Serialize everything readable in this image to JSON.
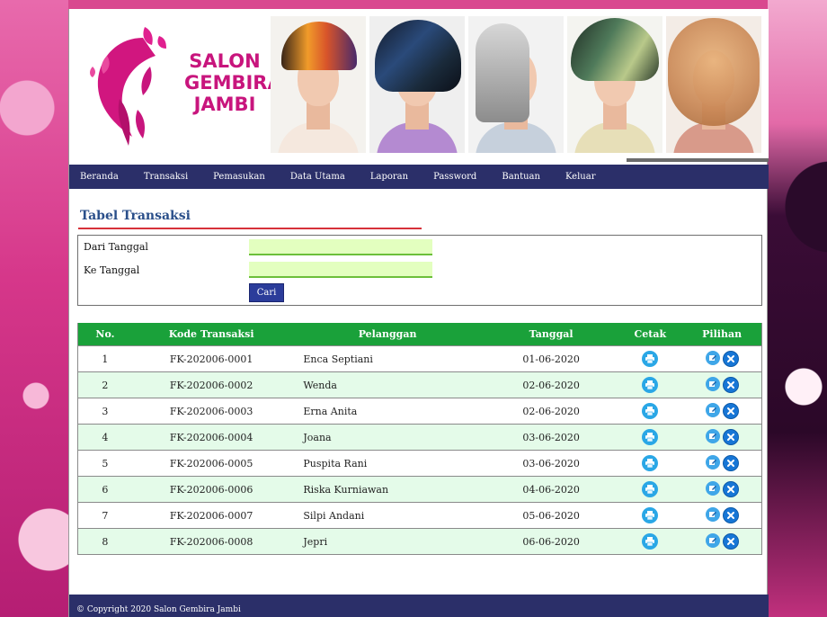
{
  "brand": {
    "name_lines": [
      "SALON",
      "GEMBIRA",
      "JAMBI"
    ],
    "color": "#c8157d"
  },
  "navbar": {
    "items": [
      "Beranda",
      "Transaksi",
      "Pemasukan",
      "Data Utama",
      "Laporan",
      "Password",
      "Bantuan",
      "Keluar"
    ]
  },
  "section": {
    "title": "Tabel Transaksi"
  },
  "filter": {
    "from_label": "Dari Tanggal",
    "to_label": "Ke Tanggal",
    "from_value": "",
    "to_value": "",
    "search_label": "Cari"
  },
  "table": {
    "headers": [
      "No.",
      "Kode Transaksi",
      "Pelanggan",
      "Tanggal",
      "Cetak",
      "Pilihan"
    ],
    "rows": [
      {
        "no": "1",
        "kode": "FK-202006-0001",
        "pelanggan": "Enca Septiani",
        "tanggal": "01-06-2020"
      },
      {
        "no": "2",
        "kode": "FK-202006-0002",
        "pelanggan": "Wenda",
        "tanggal": "02-06-2020"
      },
      {
        "no": "3",
        "kode": "FK-202006-0003",
        "pelanggan": "Erna Anita",
        "tanggal": "02-06-2020"
      },
      {
        "no": "4",
        "kode": "FK-202006-0004",
        "pelanggan": "Joana",
        "tanggal": "03-06-2020"
      },
      {
        "no": "5",
        "kode": "FK-202006-0005",
        "pelanggan": "Puspita Rani",
        "tanggal": "03-06-2020"
      },
      {
        "no": "6",
        "kode": "FK-202006-0006",
        "pelanggan": "Riska Kurniawan",
        "tanggal": "04-06-2020"
      },
      {
        "no": "7",
        "kode": "FK-202006-0007",
        "pelanggan": "Silpi Andani",
        "tanggal": "05-06-2020"
      },
      {
        "no": "8",
        "kode": "FK-202006-0008",
        "pelanggan": "Jepri",
        "tanggal": "06-06-2020"
      }
    ],
    "row_icons": {
      "cetak": "print-icon",
      "edit": "edit-icon",
      "delete": "delete-icon"
    },
    "header_color": "#1aa13a",
    "alt_row_color": "#e4fbe9"
  },
  "footer": {
    "copyright": "© Copyright 2020 Salon Gembira Jambi"
  },
  "colors": {
    "nav_bg": "#2b2f69",
    "title_color": "#2a4f8a",
    "input_bg": "#e3ffbf",
    "button_bg": "#2b3c9a"
  }
}
